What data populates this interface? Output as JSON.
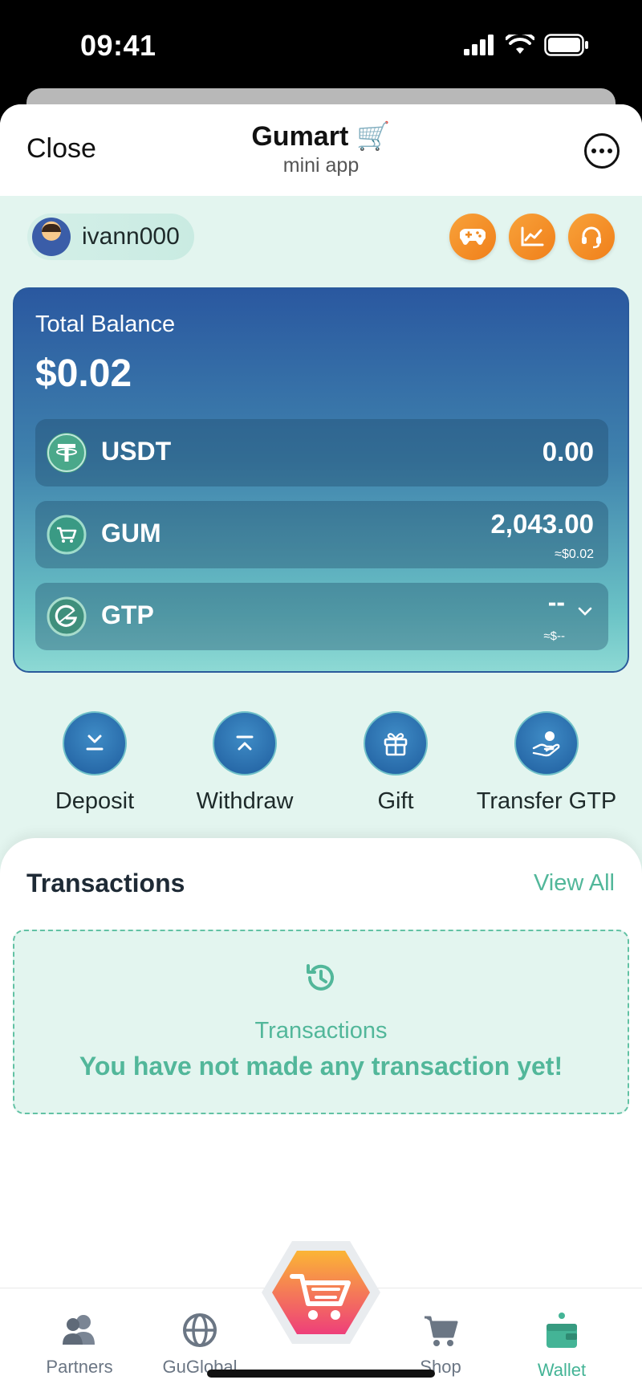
{
  "status_bar": {
    "time": "09:41"
  },
  "header": {
    "close_label": "Close",
    "title": "Gumart",
    "title_emoji": "🛒",
    "subtitle": "mini app"
  },
  "user": {
    "username": "ivann000"
  },
  "quick_icons": [
    "gamepad-icon",
    "chart-icon",
    "headset-icon"
  ],
  "balance": {
    "label": "Total Balance",
    "value": "$0.02",
    "assets": [
      {
        "name": "USDT",
        "amount": "0.00",
        "usd": ""
      },
      {
        "name": "GUM",
        "amount": "2,043.00",
        "usd": "≈$0.02"
      },
      {
        "name": "GTP",
        "amount": "--",
        "usd": "≈$--"
      }
    ]
  },
  "actions": [
    {
      "label": "Deposit",
      "icon": "deposit-icon"
    },
    {
      "label": "Withdraw",
      "icon": "withdraw-icon"
    },
    {
      "label": "Gift",
      "icon": "gift-icon"
    },
    {
      "label": "Transfer GTP",
      "icon": "transfer-icon"
    }
  ],
  "transactions": {
    "title": "Transactions",
    "view_all": "View All",
    "empty_label": "Transactions",
    "empty_message": "You have not made any transaction yet!"
  },
  "nav": {
    "items": [
      {
        "label": "Partners",
        "icon": "partners-icon"
      },
      {
        "label": "GuGlobal",
        "icon": "globe-icon"
      },
      {
        "label": "Shop",
        "icon": "cart-icon"
      },
      {
        "label": "Wallet",
        "icon": "wallet-icon"
      }
    ],
    "active": "Wallet"
  },
  "colors": {
    "accent": "#52b79a",
    "card_top": "#2a58a0",
    "card_bottom": "#8dd9d4",
    "orange": "#f39227",
    "background": "#e3f5ef"
  }
}
